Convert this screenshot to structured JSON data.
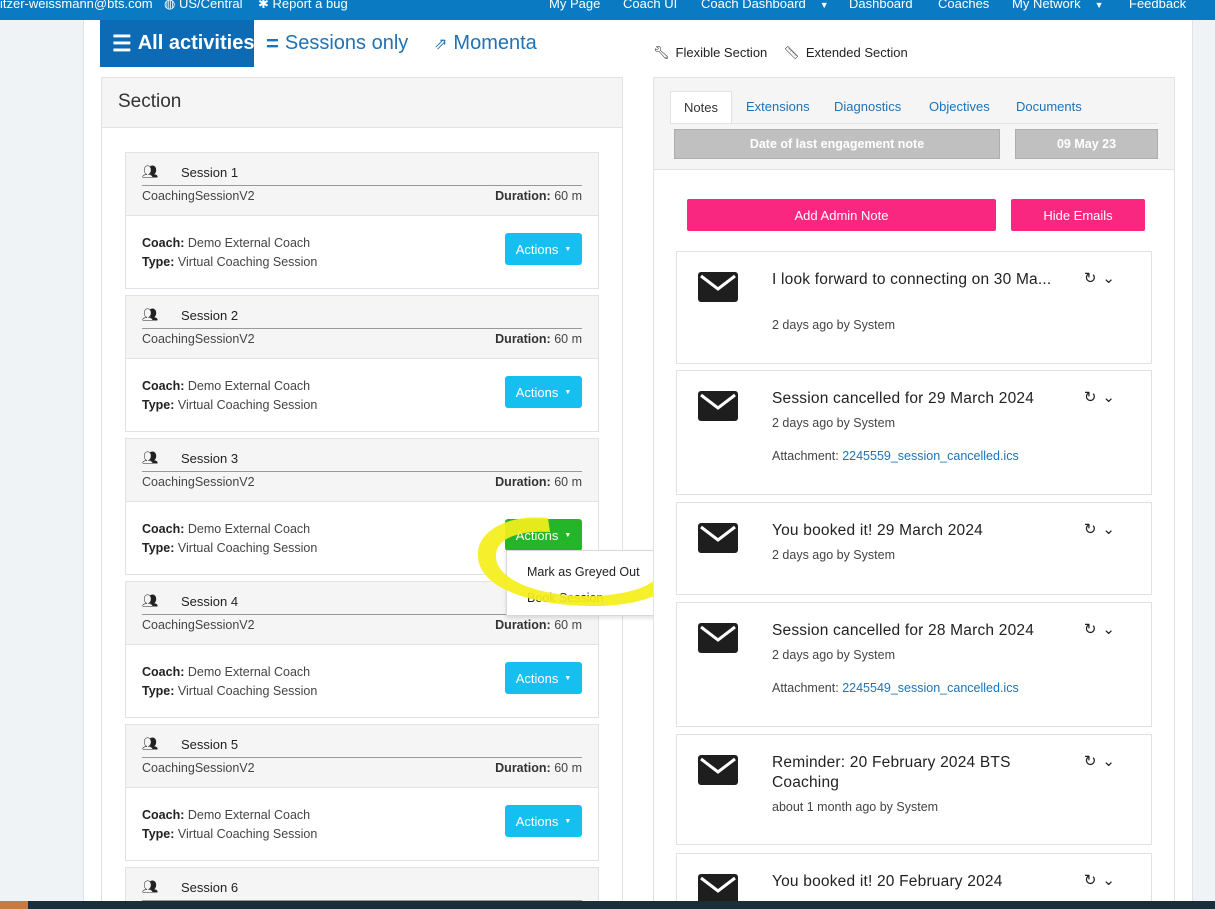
{
  "topbar": {
    "email": "itzer-weissmann@bts.com",
    "timezone": "US/Central",
    "report_bug": "Report a bug",
    "nav": [
      "My Page",
      "Coach UI",
      "Coach Dashboard",
      "Dashboard",
      "Coaches",
      "My Network",
      "Feedback"
    ]
  },
  "filters": {
    "all": "All activities",
    "sessions": "Sessions only",
    "momenta": "Momenta"
  },
  "section_links": {
    "flexible": "Flexible Section",
    "extended": "Extended Section"
  },
  "section": {
    "title": "Section",
    "coach_label": "Coach:",
    "type_label": "Type:",
    "duration_label": "Duration:",
    "actions_label": "Actions",
    "sessions": [
      {
        "name": "Session 1",
        "kind": "CoachingSessionV2",
        "duration": "60 m",
        "coach": "Demo External Coach",
        "type": "Virtual Coaching Session"
      },
      {
        "name": "Session 2",
        "kind": "CoachingSessionV2",
        "duration": "60 m",
        "coach": "Demo External Coach",
        "type": "Virtual Coaching Session"
      },
      {
        "name": "Session 3",
        "kind": "CoachingSessionV2",
        "duration": "60 m",
        "coach": "Demo External Coach",
        "type": "Virtual Coaching Session"
      },
      {
        "name": "Session 4",
        "kind": "CoachingSessionV2",
        "duration": "60 m",
        "coach": "Demo External Coach",
        "type": "Virtual Coaching Session"
      },
      {
        "name": "Session 5",
        "kind": "CoachingSessionV2",
        "duration": "60 m",
        "coach": "Demo External Coach",
        "type": "Virtual Coaching Session"
      },
      {
        "name": "Session 6",
        "kind": "",
        "duration": "",
        "coach": "",
        "type": ""
      }
    ],
    "dropdown": [
      "Mark as Greyed Out",
      "Book Session"
    ]
  },
  "right": {
    "tabs": [
      "Notes",
      "Extensions",
      "Diagnostics",
      "Objectives",
      "Documents"
    ],
    "last_note_label": "Date of last engagement note",
    "last_note_date": "09 May 23",
    "add_admin_note": "Add Admin Note",
    "hide_emails": "Hide Emails",
    "attachment_label": "Attachment:",
    "notes": [
      {
        "title": "I look forward to connecting on 30 Ma...",
        "meta": "2 days ago by System",
        "attachment": ""
      },
      {
        "title": "Session cancelled for 29 March 2024",
        "meta": "2 days ago by System",
        "attachment": "2245559_session_cancelled.ics"
      },
      {
        "title": "You booked it! 29 March 2024",
        "meta": "2 days ago by System",
        "attachment": ""
      },
      {
        "title": "Session cancelled for 28 March 2024",
        "meta": "2 days ago by System",
        "attachment": "2245549_session_cancelled.ics"
      },
      {
        "title": "Reminder: 20 February 2024 BTS Coaching",
        "meta": "about 1 month ago by System",
        "attachment": ""
      },
      {
        "title": "You booked it! 20 February 2024",
        "meta": "",
        "attachment": ""
      }
    ]
  },
  "colors": {
    "nav_blue": "#0a7bc2",
    "actions_cyan": "#15c0f0",
    "actions_green": "#24b629",
    "pink": "#fa2781",
    "highlight_yellow": "#f5ef1a"
  }
}
